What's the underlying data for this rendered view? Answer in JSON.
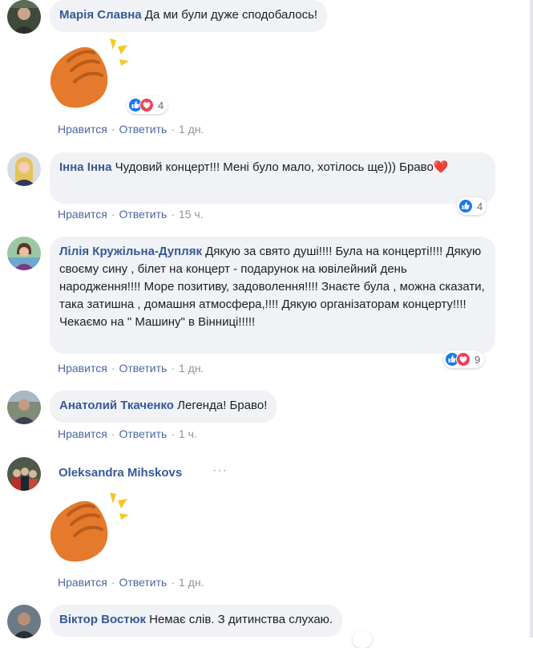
{
  "actions": {
    "like": "Нравится",
    "reply": "Ответить",
    "sep": "·"
  },
  "comments": [
    {
      "author": "Марія Славна",
      "text": "Да ми були дуже сподобалось!",
      "time": "1 дн.",
      "reactions": {
        "count": "4",
        "types": [
          "like",
          "love"
        ]
      },
      "sticker": "clapping-hands"
    },
    {
      "author": "Інна Інна",
      "text": "Чудовий концерт!!! Мені було мало, хотілось ще))) Браво",
      "emoji": "❤️",
      "time": "15 ч.",
      "reactions": {
        "count": "4",
        "types": [
          "like"
        ]
      }
    },
    {
      "author": "Лілія Кружільна-Дупляк",
      "text": "Дякую за свято душі!!!! Була на концерті!!!! Дякую своєму сину , білет на концерт - подарунок на ювілейний день народження!!!! Море позитиву, задоволення!!!! Знаєте була , можна сказати, така затишна , домашня атмосфера,!!!! Дякую організаторам концерту!!!! Чекаємо на \" Машину\" в Вінниці!!!!!",
      "time": "1 дн.",
      "reactions": {
        "count": "9",
        "types": [
          "like",
          "love"
        ]
      }
    },
    {
      "author": "Анатолий Ткаченко",
      "text": "Легенда! Браво!",
      "time": "1 ч."
    },
    {
      "author": "Oleksandra Mihskovs",
      "more": "···",
      "time": "1 дн.",
      "sticker": "clapping-hands"
    },
    {
      "author": "Віктор Востюк",
      "text": "Немає слів. З дитинства слухаю."
    }
  ],
  "colors": {
    "link": "#385898",
    "bubble": "#f0f2f5",
    "like": "#1877f2",
    "love": "#f33e58",
    "meta": "#8d949e",
    "clap": "#e57a2c",
    "spark": "#f7c628"
  }
}
